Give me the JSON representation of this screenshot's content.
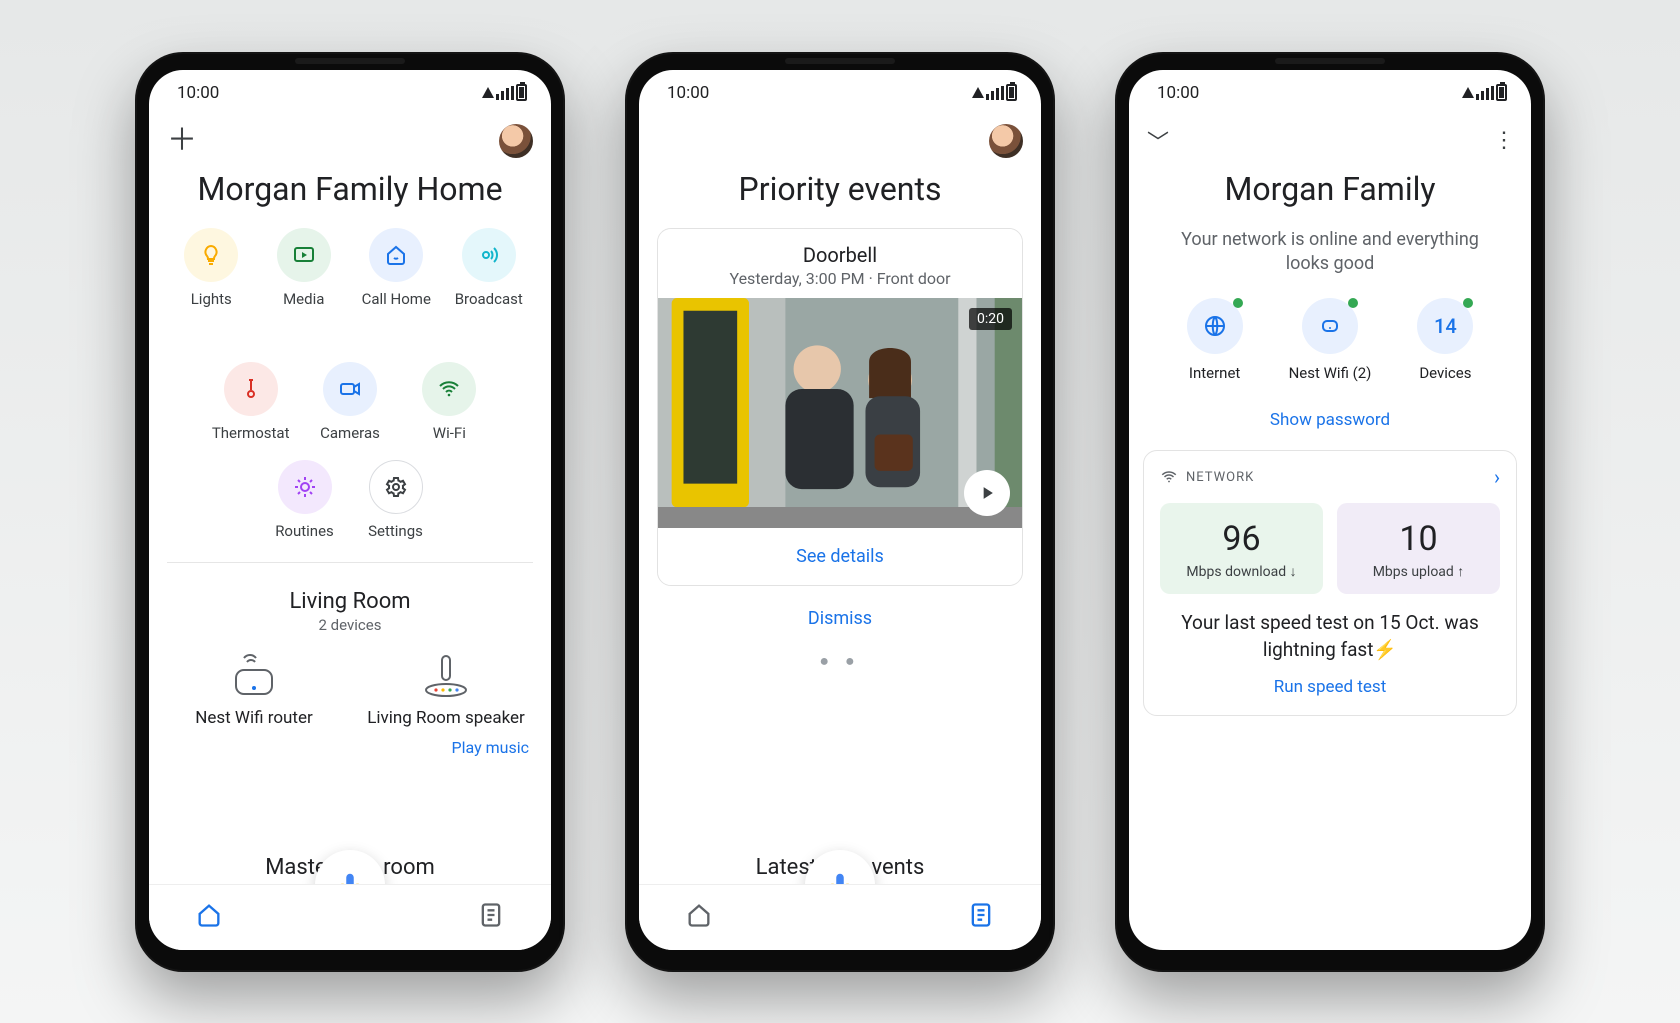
{
  "status": {
    "time": "10:00"
  },
  "phone1": {
    "title": "Morgan Family Home",
    "actions": [
      {
        "label": "Lights",
        "icon": "bulb",
        "bg": "#fef7e0",
        "fg": "#f9ab00"
      },
      {
        "label": "Media",
        "icon": "play-tv",
        "bg": "#e6f4ea",
        "fg": "#188038"
      },
      {
        "label": "Call Home",
        "icon": "home-call",
        "bg": "#e8f0fe",
        "fg": "#1a73e8"
      },
      {
        "label": "Broadcast",
        "icon": "broadcast",
        "bg": "#e4f7fb",
        "fg": "#12b5cb"
      },
      {
        "label": "Thermostat",
        "icon": "thermo",
        "bg": "#fce8e6",
        "fg": "#d93025"
      },
      {
        "label": "Cameras",
        "icon": "camera",
        "bg": "#e8f0fe",
        "fg": "#1a73e8"
      },
      {
        "label": "Wi-Fi",
        "icon": "wifi",
        "bg": "#e6f4ea",
        "fg": "#188038"
      },
      {
        "label": "Routines",
        "icon": "routines",
        "bg": "#f3e8fd",
        "fg": "#a142f4"
      },
      {
        "label": "Settings",
        "icon": "gear",
        "bg": "outline",
        "fg": "#3c4043"
      }
    ],
    "room": {
      "name": "Living Room",
      "subtitle": "2 devices"
    },
    "devices": [
      {
        "name": "Nest Wifi router"
      },
      {
        "name": "Living Room speaker"
      }
    ],
    "play_music": "Play music",
    "next_room_partial": "Master         room"
  },
  "phone2": {
    "title": "Priority events",
    "event": {
      "title": "Doorbell",
      "meta": "Yesterday, 3:00 PM · Front door",
      "duration": "0:20",
      "see_details": "See details"
    },
    "dismiss": "Dismiss",
    "latest_partial": "Latest          vents"
  },
  "phone3": {
    "title": "Morgan Family",
    "subtitle": "Your network is online and everything looks good",
    "items": {
      "internet": "Internet",
      "wifi": "Nest Wifi (2)",
      "devices_label": "Devices",
      "devices_count": "14"
    },
    "show_password": "Show password",
    "card": {
      "header": "NETWORK",
      "download_value": "96",
      "download_label": "Mbps download ↓",
      "upload_value": "10",
      "upload_label": "Mbps upload ↑",
      "footer": "Your last speed test on 15 Oct. was lightning fast⚡",
      "run": "Run speed test"
    }
  }
}
